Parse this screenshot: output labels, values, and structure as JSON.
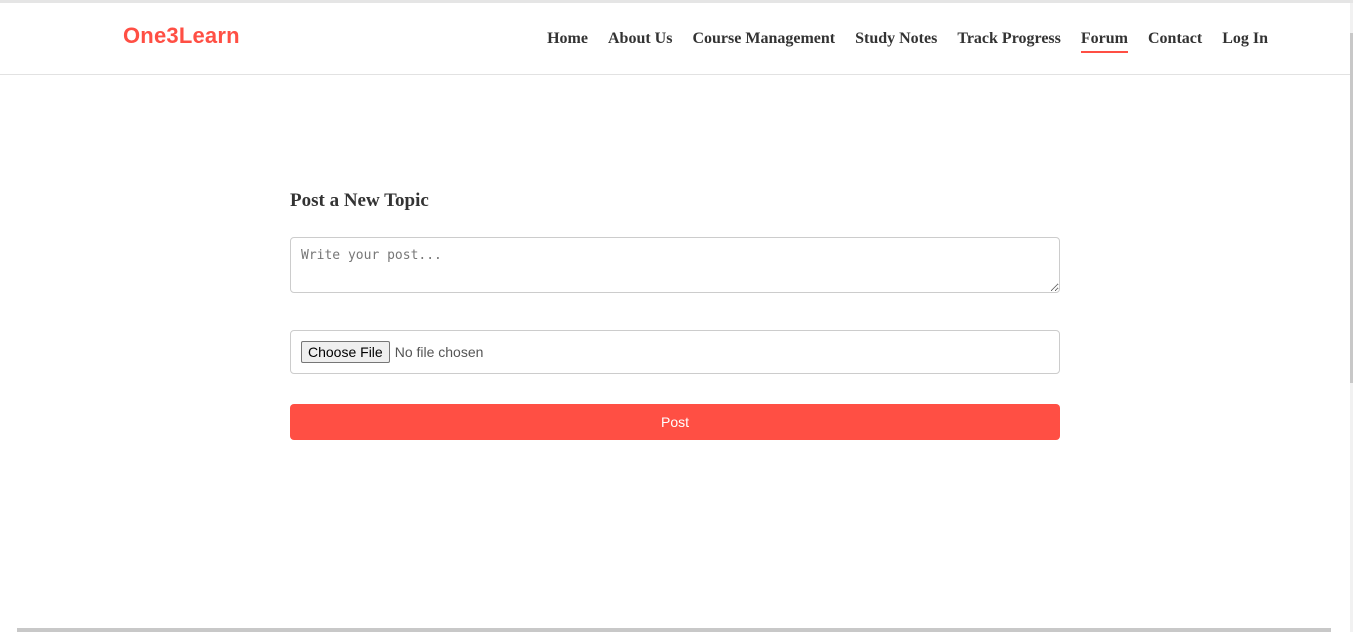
{
  "header": {
    "logo_text": "One3Learn",
    "nav": [
      {
        "label": "Home"
      },
      {
        "label": "About Us"
      },
      {
        "label": "Course Management"
      },
      {
        "label": "Study Notes"
      },
      {
        "label": "Track Progress"
      },
      {
        "label": "Forum",
        "active": true
      },
      {
        "label": "Contact"
      },
      {
        "label": "Log In"
      }
    ]
  },
  "form": {
    "title": "Post a New Topic",
    "post_placeholder": "Write your post...",
    "post_value": "",
    "file_button_label": "Choose File",
    "file_status": "No file chosen",
    "submit_label": "Post"
  },
  "colors": {
    "accent": "#ff4f44",
    "text": "#333333"
  }
}
